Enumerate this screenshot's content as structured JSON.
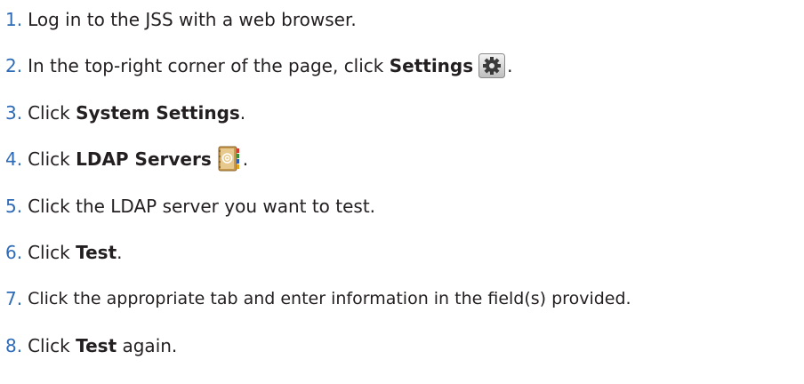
{
  "steps": [
    {
      "num": "1.",
      "parts": [
        "Log in to the JSS with a web browser."
      ]
    },
    {
      "num": "2.",
      "parts": [
        "In the top-right corner of the page, click ",
        "Settings",
        "."
      ]
    },
    {
      "num": "3.",
      "parts": [
        "Click ",
        "System Settings",
        "."
      ]
    },
    {
      "num": "4.",
      "parts": [
        "Click ",
        "LDAP Servers",
        "."
      ]
    },
    {
      "num": "5.",
      "parts": [
        "Click the LDAP server you want to test."
      ]
    },
    {
      "num": "6.",
      "parts": [
        "Click ",
        "Test",
        "."
      ]
    },
    {
      "num": "7.",
      "parts": [
        "Click the appropriate tab and enter information in the field(s) provided."
      ]
    },
    {
      "num": "8.",
      "parts": [
        "Click ",
        "Test",
        " again."
      ]
    }
  ],
  "icons": {
    "settings": "gear-icon",
    "ldap": "address-book-icon"
  },
  "colors": {
    "number": "#2e6bb7",
    "text": "#231f20"
  }
}
